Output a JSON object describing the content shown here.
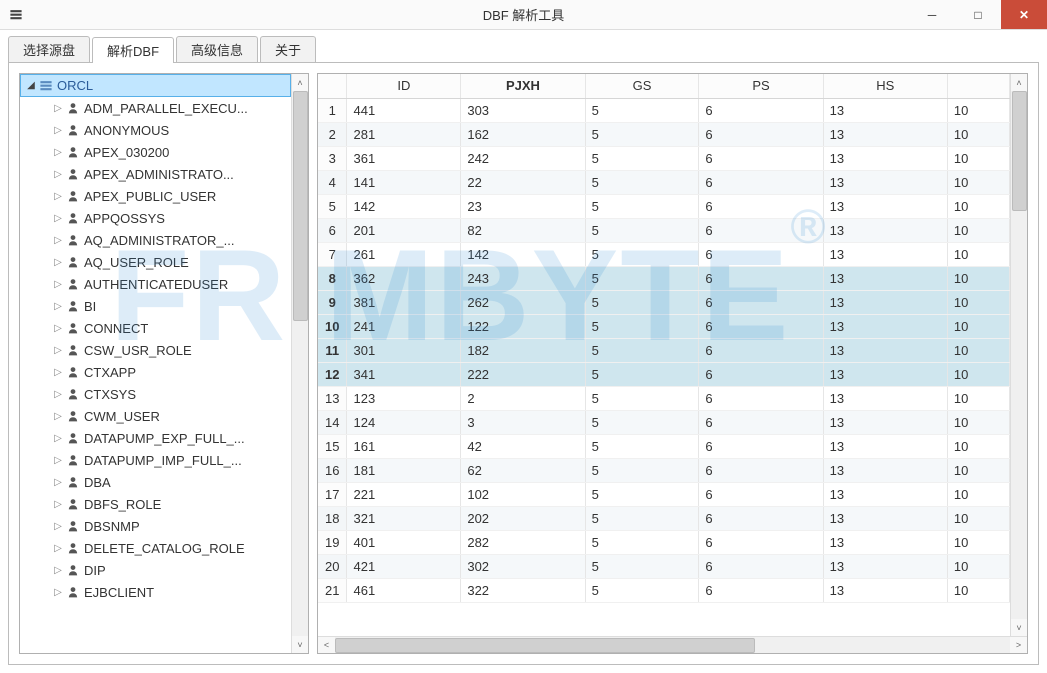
{
  "window": {
    "title": "DBF 解析工具"
  },
  "tabs": [
    {
      "label": "选择源盘"
    },
    {
      "label": "解析DBF"
    },
    {
      "label": "高级信息"
    },
    {
      "label": "关于"
    }
  ],
  "tree": {
    "root": {
      "label": "ORCL"
    },
    "items": [
      {
        "label": "ADM_PARALLEL_EXECU..."
      },
      {
        "label": "ANONYMOUS"
      },
      {
        "label": "APEX_030200"
      },
      {
        "label": "APEX_ADMINISTRATO..."
      },
      {
        "label": "APEX_PUBLIC_USER"
      },
      {
        "label": "APPQOSSYS"
      },
      {
        "label": "AQ_ADMINISTRATOR_..."
      },
      {
        "label": "AQ_USER_ROLE"
      },
      {
        "label": "AUTHENTICATEDUSER"
      },
      {
        "label": "BI"
      },
      {
        "label": "CONNECT"
      },
      {
        "label": "CSW_USR_ROLE"
      },
      {
        "label": "CTXAPP"
      },
      {
        "label": "CTXSYS"
      },
      {
        "label": "CWM_USER"
      },
      {
        "label": "DATAPUMP_EXP_FULL_..."
      },
      {
        "label": "DATAPUMP_IMP_FULL_..."
      },
      {
        "label": "DBA"
      },
      {
        "label": "DBFS_ROLE"
      },
      {
        "label": "DBSNMP"
      },
      {
        "label": "DELETE_CATALOG_ROLE"
      },
      {
        "label": "DIP"
      },
      {
        "label": "EJBCLIENT"
      }
    ]
  },
  "grid": {
    "columns": [
      "ID",
      "PJXH",
      "GS",
      "PS",
      "HS",
      ""
    ],
    "rows": [
      {
        "n": 1,
        "id": "441",
        "pjxh": "303",
        "gs": "5",
        "ps": "6",
        "hs": "13",
        "x": "10"
      },
      {
        "n": 2,
        "id": "281",
        "pjxh": "162",
        "gs": "5",
        "ps": "6",
        "hs": "13",
        "x": "10"
      },
      {
        "n": 3,
        "id": "361",
        "pjxh": "242",
        "gs": "5",
        "ps": "6",
        "hs": "13",
        "x": "10"
      },
      {
        "n": 4,
        "id": "141",
        "pjxh": "22",
        "gs": "5",
        "ps": "6",
        "hs": "13",
        "x": "10"
      },
      {
        "n": 5,
        "id": "142",
        "pjxh": "23",
        "gs": "5",
        "ps": "6",
        "hs": "13",
        "x": "10"
      },
      {
        "n": 6,
        "id": "201",
        "pjxh": "82",
        "gs": "5",
        "ps": "6",
        "hs": "13",
        "x": "10"
      },
      {
        "n": 7,
        "id": "261",
        "pjxh": "142",
        "gs": "5",
        "ps": "6",
        "hs": "13",
        "x": "10"
      },
      {
        "n": 8,
        "id": "362",
        "pjxh": "243",
        "gs": "5",
        "ps": "6",
        "hs": "13",
        "x": "10",
        "hl": true
      },
      {
        "n": 9,
        "id": "381",
        "pjxh": "262",
        "gs": "5",
        "ps": "6",
        "hs": "13",
        "x": "10",
        "hl": true
      },
      {
        "n": 10,
        "id": "241",
        "pjxh": "122",
        "gs": "5",
        "ps": "6",
        "hs": "13",
        "x": "10",
        "hl": true
      },
      {
        "n": 11,
        "id": "301",
        "pjxh": "182",
        "gs": "5",
        "ps": "6",
        "hs": "13",
        "x": "10",
        "hl": true
      },
      {
        "n": 12,
        "id": "341",
        "pjxh": "222",
        "gs": "5",
        "ps": "6",
        "hs": "13",
        "x": "10",
        "hl": true
      },
      {
        "n": 13,
        "id": "123",
        "pjxh": "2",
        "gs": "5",
        "ps": "6",
        "hs": "13",
        "x": "10"
      },
      {
        "n": 14,
        "id": "124",
        "pjxh": "3",
        "gs": "5",
        "ps": "6",
        "hs": "13",
        "x": "10"
      },
      {
        "n": 15,
        "id": "161",
        "pjxh": "42",
        "gs": "5",
        "ps": "6",
        "hs": "13",
        "x": "10"
      },
      {
        "n": 16,
        "id": "181",
        "pjxh": "62",
        "gs": "5",
        "ps": "6",
        "hs": "13",
        "x": "10"
      },
      {
        "n": 17,
        "id": "221",
        "pjxh": "102",
        "gs": "5",
        "ps": "6",
        "hs": "13",
        "x": "10"
      },
      {
        "n": 18,
        "id": "321",
        "pjxh": "202",
        "gs": "5",
        "ps": "6",
        "hs": "13",
        "x": "10"
      },
      {
        "n": 19,
        "id": "401",
        "pjxh": "282",
        "gs": "5",
        "ps": "6",
        "hs": "13",
        "x": "10"
      },
      {
        "n": 20,
        "id": "421",
        "pjxh": "302",
        "gs": "5",
        "ps": "6",
        "hs": "13",
        "x": "10"
      },
      {
        "n": 21,
        "id": "461",
        "pjxh": "322",
        "gs": "5",
        "ps": "6",
        "hs": "13",
        "x": "10"
      }
    ]
  },
  "watermark": {
    "text": "FR MBYTE",
    "reg": "®"
  }
}
